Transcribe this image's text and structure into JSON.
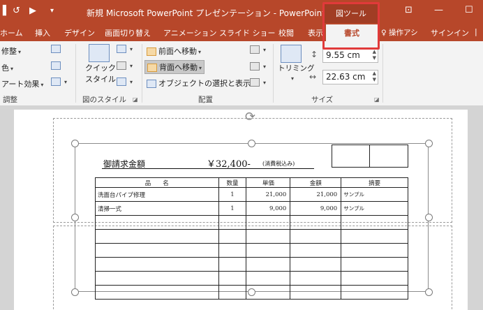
{
  "titlebar": {
    "quick_access": {
      "undo": "↺",
      "redo_start": "▶",
      "customize": "▾"
    },
    "title": "新規 Microsoft PowerPoint プレゼンテーション - PowerPoint",
    "context_tab_group": "図ツール",
    "window": {
      "ribbon_options": "⊡",
      "minimize": "—",
      "maximize": "☐"
    }
  },
  "tabs": {
    "items": [
      "ホーム",
      "挿入",
      "デザイン",
      "画面切り替え",
      "アニメーション",
      "スライド ショー",
      "校閲",
      "表示",
      "書式"
    ],
    "active": "書式",
    "tell_me": "操作アシ",
    "sign_in": "サインイン"
  },
  "ribbon": {
    "adjust": {
      "corrections": "修整",
      "color": "色",
      "artistic_effects": "アート効果",
      "label": "調整"
    },
    "picture_styles": {
      "quick_styles_line1": "クイック",
      "quick_styles_line2": "スタイル",
      "label": "図のスタイル"
    },
    "arrange": {
      "bring_forward": "前面へ移動",
      "send_backward": "背面へ移動",
      "selection_pane": "オブジェクトの選択と表示",
      "label": "配置"
    },
    "size": {
      "crop": "トリミング",
      "height": "9.55 cm",
      "width": "22.63 cm",
      "label": "サイズ"
    }
  },
  "invoice": {
    "claim_label": "御請求金額",
    "claim_amount": "￥32,400-",
    "tax_note": "(消費税込み)",
    "headers": {
      "item": "品　　名",
      "qty": "数量",
      "unit_price": "単価",
      "amount": "金額",
      "note": "摘要"
    },
    "rows": [
      {
        "item": "洗面台パイプ修理",
        "qty": "1",
        "unit_price": "21,000",
        "amount": "21,000",
        "note": "サンプル"
      },
      {
        "item": "清掃一式",
        "qty": "1",
        "unit_price": "9,000",
        "amount": "9,000",
        "note": "サンプル"
      }
    ]
  }
}
